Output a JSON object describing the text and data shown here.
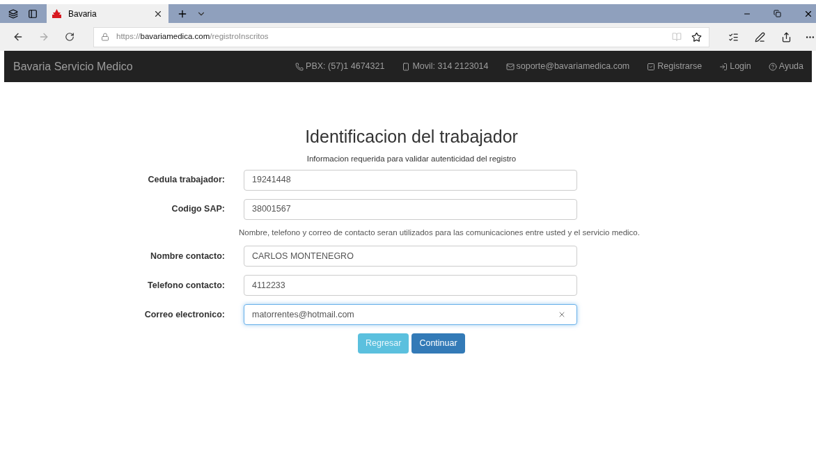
{
  "browser": {
    "tab": {
      "title": "Bavaria",
      "selected": true
    },
    "url": {
      "scheme": "https://",
      "host": "bavariamedica.com",
      "path": "/registroInscritos"
    }
  },
  "navbar": {
    "brand": "Bavaria Servicio Medico",
    "items": [
      {
        "kind": "phone",
        "label": "PBX: (57)1 4674321"
      },
      {
        "kind": "mobile",
        "label": "Movil: 314 2123014"
      },
      {
        "kind": "mail",
        "label": "soporte@bavariamedica.com"
      },
      {
        "kind": "register",
        "label": "Registrarse"
      },
      {
        "kind": "login",
        "label": "Login"
      },
      {
        "kind": "help",
        "label": "Ayuda"
      }
    ]
  },
  "form": {
    "title": "Identificacion del trabajador",
    "subtitle": "Informacion requerida para validar autenticidad del registro",
    "groups": [
      {
        "fields": [
          {
            "label": "Cedula trabajador:",
            "value": "19241448",
            "focused": false
          },
          {
            "label": "Codigo SAP:",
            "value": "38001567",
            "focused": false
          }
        ]
      },
      {
        "note": "Nombre, telefono y correo de contacto seran utilizados para las comunicaciones entre usted y el servicio medico.",
        "fields": [
          {
            "label": "Nombre contacto:",
            "value": "CARLOS MONTENEGRO",
            "focused": false
          },
          {
            "label": "Telefono contacto:",
            "value": "4112233",
            "focused": false
          },
          {
            "label": "Correo electronico:",
            "value": "matorrentes@hotmail.com",
            "focused": true
          }
        ]
      }
    ],
    "buttons": [
      {
        "kind": "info",
        "label": "Regresar"
      },
      {
        "kind": "primary",
        "label": "Continuar"
      }
    ]
  }
}
